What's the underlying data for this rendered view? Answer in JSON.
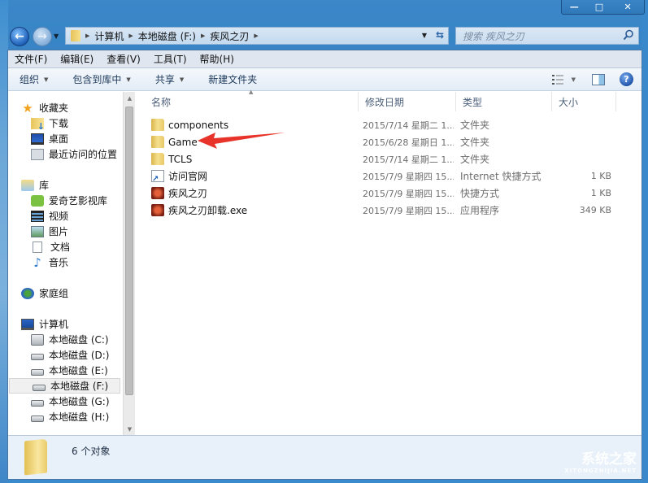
{
  "window": {
    "caption_buttons": {
      "minimize": "—",
      "maximize": "□",
      "close": "✕"
    }
  },
  "navigation": {
    "back_icon": "back-arrow-icon",
    "forward_icon": "forward-arrow-icon",
    "breadcrumb": [
      "计算机",
      "本地磁盘 (F:)",
      "疾风之刃"
    ],
    "search_placeholder": "搜索 疾风之刃"
  },
  "menubar": {
    "items": [
      "文件(F)",
      "编辑(E)",
      "查看(V)",
      "工具(T)",
      "帮助(H)"
    ]
  },
  "toolbar": {
    "organize": "组织",
    "include_in_library": "包含到库中",
    "share": "共享",
    "new_folder": "新建文件夹"
  },
  "navpane": {
    "favorites": {
      "label": "收藏夹",
      "items": [
        "下载",
        "桌面",
        "最近访问的位置"
      ]
    },
    "libraries": {
      "label": "库",
      "items": [
        "爱奇艺影视库",
        "视频",
        "图片",
        "文档",
        "音乐"
      ]
    },
    "homegroup": {
      "label": "家庭组"
    },
    "computer": {
      "label": "计算机",
      "drives": [
        "本地磁盘 (C:)",
        "本地磁盘 (D:)",
        "本地磁盘 (E:)",
        "本地磁盘 (F:)",
        "本地磁盘 (G:)",
        "本地磁盘 (H:)"
      ],
      "selected": "本地磁盘 (F:)"
    }
  },
  "filelist": {
    "columns": [
      "名称",
      "修改日期",
      "类型",
      "大小"
    ],
    "rows": [
      {
        "name": "components",
        "date": "2015/7/14 星期二 1...",
        "type": "文件夹",
        "size": "",
        "icon": "folder"
      },
      {
        "name": "Game",
        "date": "2015/6/28 星期日 1...",
        "type": "文件夹",
        "size": "",
        "icon": "folder"
      },
      {
        "name": "TCLS",
        "date": "2015/7/14 星期二 1...",
        "type": "文件夹",
        "size": "",
        "icon": "folder"
      },
      {
        "name": "访问官网",
        "date": "2015/7/9 星期四 15...",
        "type": "Internet 快捷方式",
        "size": "1 KB",
        "icon": "url-shortcut"
      },
      {
        "name": "疾风之刃",
        "date": "2015/7/9 星期四 15...",
        "type": "快捷方式",
        "size": "1 KB",
        "icon": "game-shortcut"
      },
      {
        "name": "疾风之刃卸载.exe",
        "date": "2015/7/9 星期四 15...",
        "type": "应用程序",
        "size": "349 KB",
        "icon": "game-exe"
      }
    ],
    "annotation_color": "#e8332a"
  },
  "statusbar": {
    "text": "6 个对象"
  },
  "watermark": {
    "text": "系统之家",
    "sub": "XITONGZHIJIA.NET"
  }
}
